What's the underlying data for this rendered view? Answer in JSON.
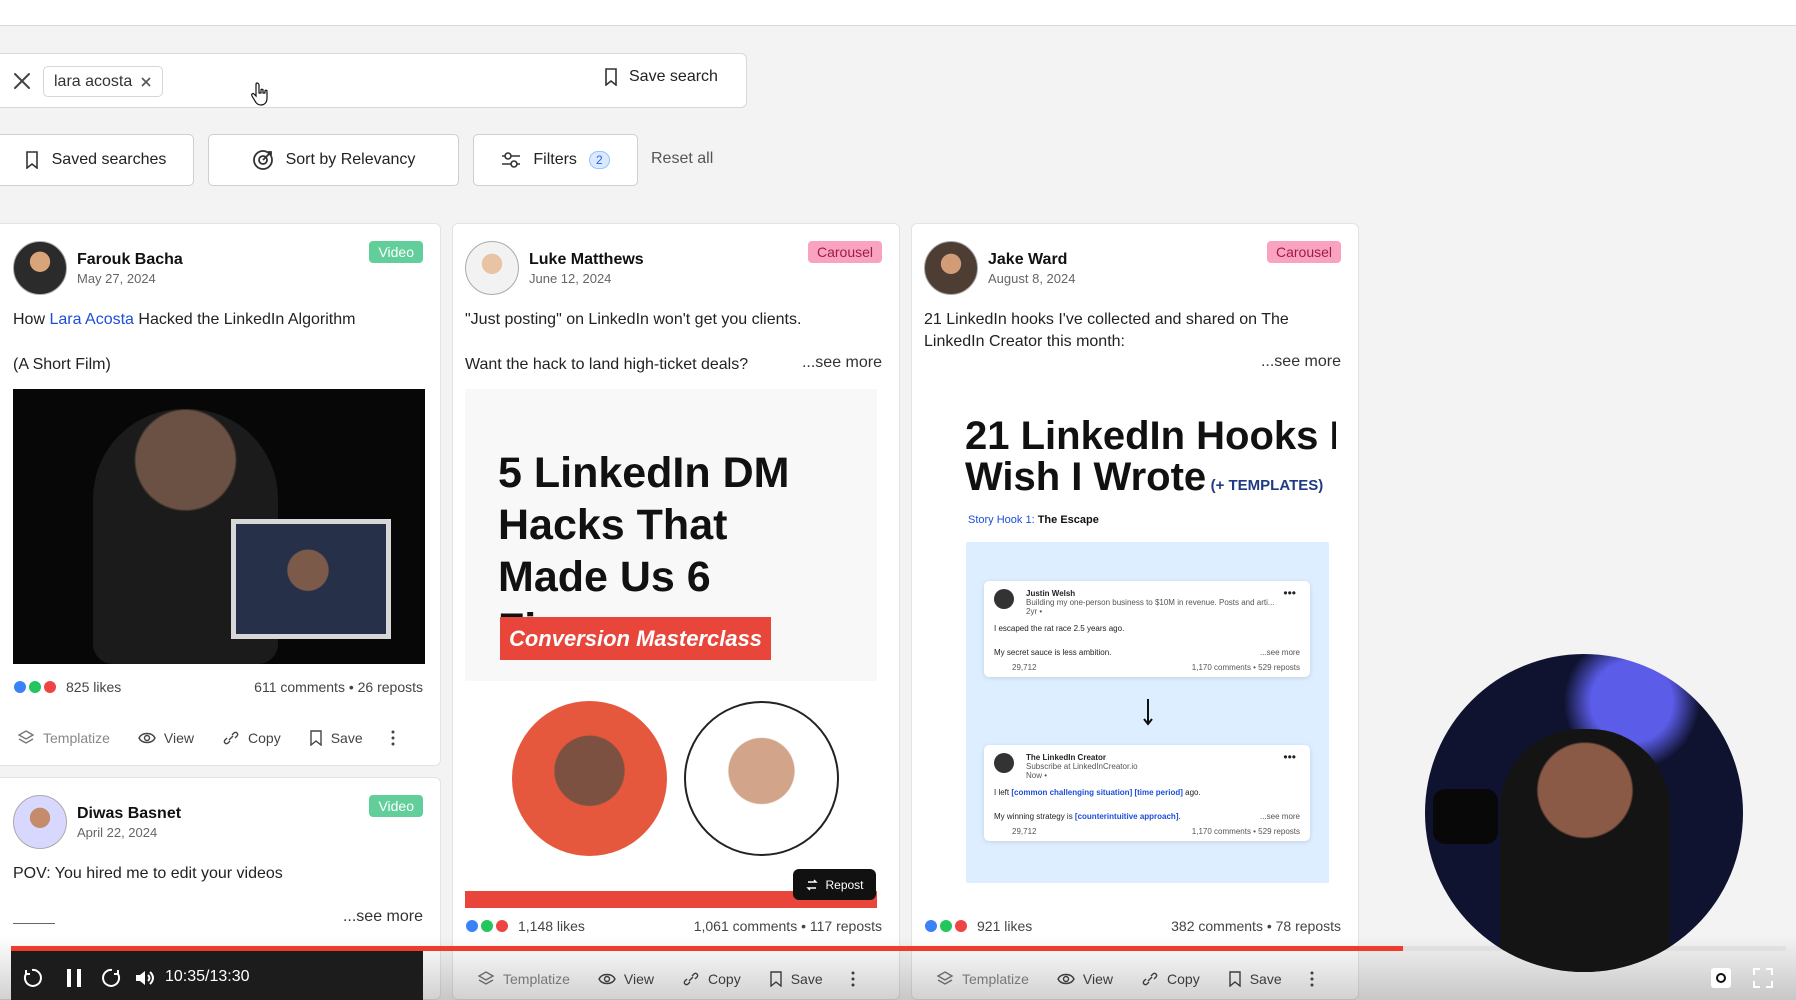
{
  "search": {
    "query_chip": "lara acosta",
    "save_label": "Save search"
  },
  "toolbar": {
    "saved_searches": "Saved searches",
    "sort": "Sort by Relevancy",
    "filters": "Filters",
    "filters_count": "2",
    "reset": "Reset all"
  },
  "posts": [
    {
      "author": "Farouk Bacha",
      "date": "May 27, 2024",
      "type": "Video",
      "text_prefix": "How ",
      "text_link": "Lara Acosta",
      "text_suffix": " Hacked the LinkedIn Algorithm",
      "line2": "(A Short Film)",
      "likes": "825 likes",
      "comments_reposts": "611 comments • 26 reposts"
    },
    {
      "author": "Luke Matthews",
      "date": "June 12, 2024",
      "type": "Carousel",
      "line1": "\"Just posting\" on LinkedIn won't get you clients.",
      "line2": "Want the hack to land high-ticket deals?",
      "see_more": "...see more",
      "media_title": "5 LinkedIn DM Hacks That Made Us 6 Figures",
      "media_banner": "Conversion Masterclass",
      "repost_label": "Repost",
      "likes": "1,148 likes",
      "comments_reposts": "1,061 comments • 117 reposts"
    },
    {
      "author": "Jake Ward",
      "date": "August 8, 2024",
      "type": "Carousel",
      "line1": "21 LinkedIn hooks I've collected and shared on The",
      "line2": "LinkedIn Creator this month:",
      "see_more": "...see more",
      "media_title_1": "21 LinkedIn Hooks I",
      "media_title_2": "Wish I Wrote",
      "media_templates": "(+ TEMPLATES)",
      "story_label": "Story Hook 1:",
      "story_value": "The Escape",
      "mini_post_1_name": "Justin Welsh",
      "mini_post_1_sub": "Building my one-person business to $10M in revenue. Posts and arti...",
      "mini_post_1_time": "2yr •",
      "mini_post_1_line1": "I escaped the rat race 2.5 years ago.",
      "mini_post_1_line2": "My secret sauce is less ambition.",
      "mini_post_1_more": "...see more",
      "mini_post_1_likes": "29,712",
      "mini_post_1_stats": "1,170 comments • 529 reposts",
      "mini_post_2_name": "The LinkedIn Creator",
      "mini_post_2_sub": "Subscribe at LinkedInCreator.io",
      "mini_post_2_time": "Now •",
      "mini_post_2_line1_prefix": "I left ",
      "mini_post_2_line1_bold": "[common challenging situation] [time period]",
      "mini_post_2_line1_suffix": " ago.",
      "mini_post_2_line2_prefix": "My winning strategy is ",
      "mini_post_2_line2_bold": "[counterintuitive approach]",
      "mini_post_2_line2_suffix": ".",
      "mini_post_2_more": "...see more",
      "mini_post_2_likes": "29,712",
      "mini_post_2_stats": "1,170 comments • 529 reposts",
      "likes": "921 likes",
      "comments_reposts": "382 comments • 78 reposts"
    },
    {
      "author": "Diwas Basnet",
      "date": "April 22, 2024",
      "type": "Video",
      "line1": "POV: You hired me to edit your videos",
      "see_more": "...see more"
    }
  ],
  "actions": {
    "templatize": "Templatize",
    "view": "View",
    "copy": "Copy",
    "save": "Save"
  },
  "player": {
    "timecode": "10:35/13:30",
    "progress_fraction": 0.784
  },
  "icons": [
    "close-icon",
    "bookmark-icon",
    "target-icon",
    "filter-icon",
    "layers-icon",
    "eye-icon",
    "link-icon",
    "more-icon",
    "pause-icon",
    "replay-icon",
    "forward-icon",
    "volume-icon",
    "settings-icon",
    "fullscreen-icon"
  ],
  "colors": {
    "video_tag": "#62cf9b",
    "carousel_tag": "#f9a3c0",
    "link": "#1d4ed8",
    "progress": "#ef3b2d",
    "banner": "#e8463a"
  }
}
